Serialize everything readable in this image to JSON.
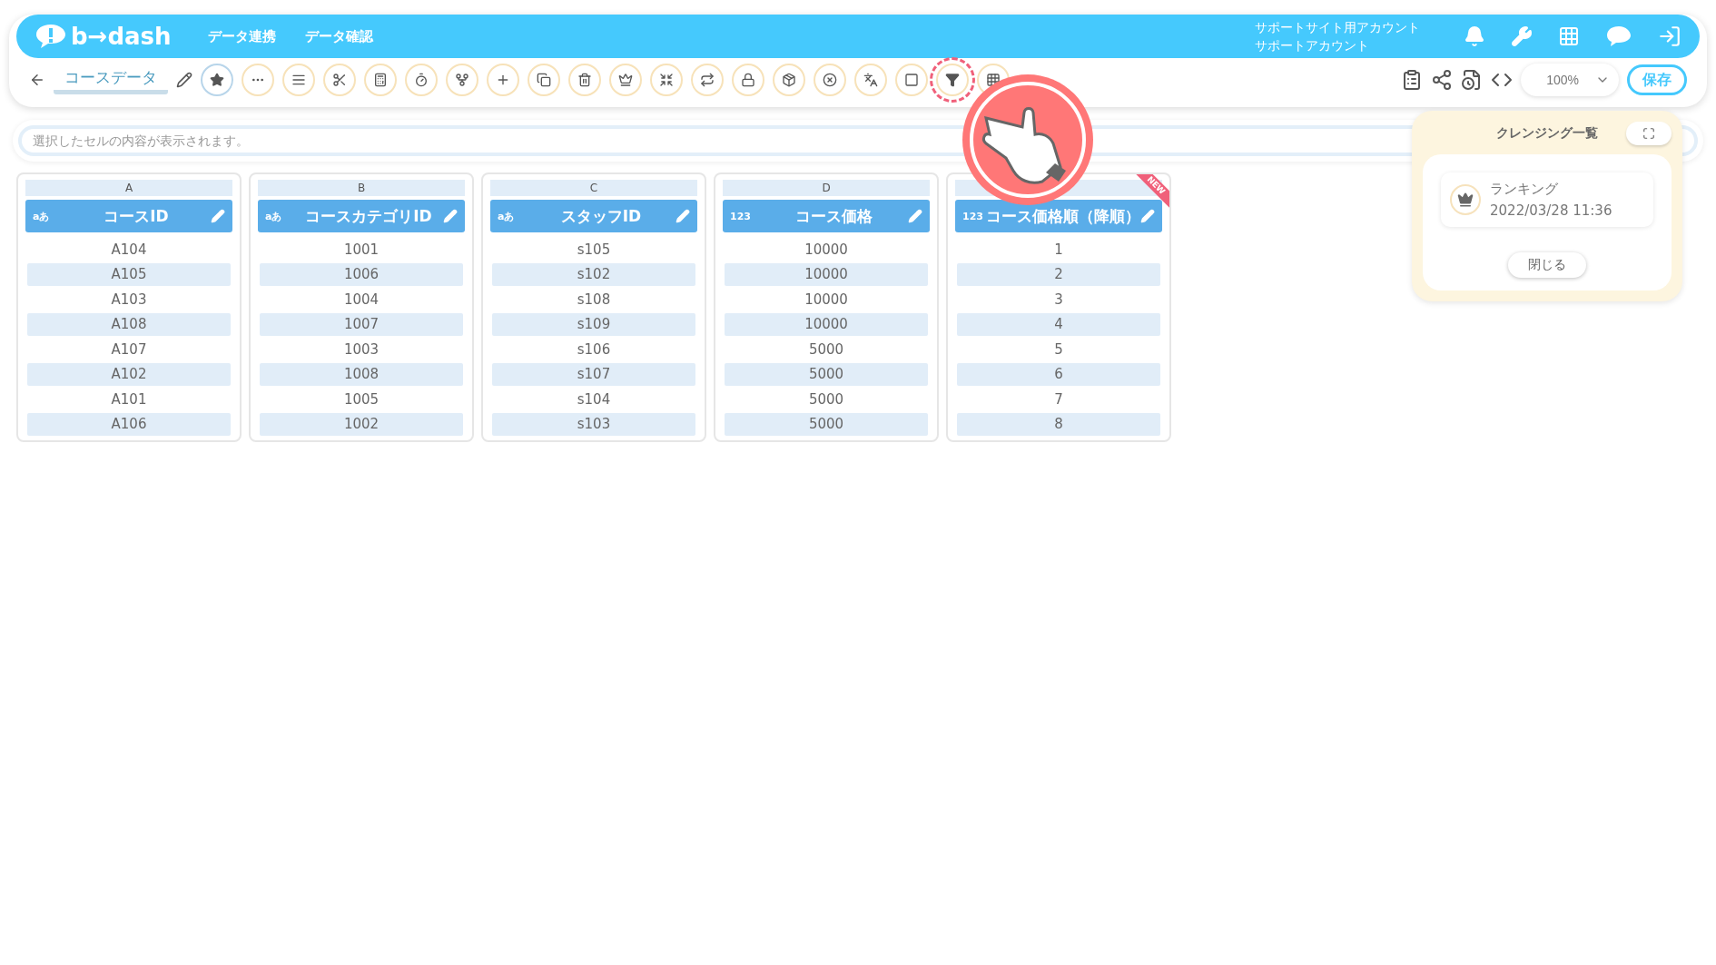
{
  "header": {
    "logo": "b→dash",
    "nav": [
      {
        "label": "データ連携"
      },
      {
        "label": "データ確認"
      }
    ],
    "account": [
      "サポートサイト用アカウント",
      "サポートアカウント"
    ]
  },
  "toolbar": {
    "title": "コースデータ",
    "tools": [
      {
        "selected": true,
        "highlighted": false
      },
      {
        "selected": false,
        "highlighted": false
      },
      {
        "selected": false,
        "highlighted": false
      },
      {
        "selected": false,
        "highlighted": false
      },
      {
        "selected": false,
        "highlighted": false
      },
      {
        "selected": false,
        "highlighted": false
      },
      {
        "selected": false,
        "highlighted": false
      },
      {
        "selected": false,
        "highlighted": false
      },
      {
        "selected": false,
        "highlighted": false
      },
      {
        "selected": false,
        "highlighted": false
      },
      {
        "selected": false,
        "highlighted": false
      },
      {
        "selected": false,
        "highlighted": false
      },
      {
        "selected": false,
        "highlighted": false
      },
      {
        "selected": false,
        "highlighted": false
      },
      {
        "selected": false,
        "highlighted": false
      },
      {
        "selected": false,
        "highlighted": false
      },
      {
        "selected": false,
        "highlighted": false
      },
      {
        "selected": false,
        "highlighted": false
      },
      {
        "selected": false,
        "highlighted": true
      },
      {
        "selected": false,
        "highlighted": false
      }
    ],
    "zoom": "100%",
    "save": "保存"
  },
  "cell_bar": {
    "placeholder": "選択したセルの内容が表示されます。"
  },
  "columns": [
    {
      "letter": "A",
      "type": "aあ",
      "title": "コースID",
      "cells": [
        "A104",
        "A105",
        "A103",
        "A108",
        "A107",
        "A102",
        "A101",
        "A106"
      ]
    },
    {
      "letter": "B",
      "type": "aあ",
      "title": "コースカテゴリID",
      "cells": [
        "1001",
        "1006",
        "1004",
        "1007",
        "1003",
        "1008",
        "1005",
        "1002"
      ]
    },
    {
      "letter": "C",
      "type": "aあ",
      "title": "スタッフID",
      "cells": [
        "s105",
        "s102",
        "s108",
        "s109",
        "s106",
        "s107",
        "s104",
        "s103"
      ]
    },
    {
      "letter": "D",
      "type": "123",
      "title": "コース価格",
      "cells": [
        "10000",
        "10000",
        "10000",
        "10000",
        "5000",
        "5000",
        "5000",
        "5000"
      ]
    },
    {
      "type": "123",
      "title": "コース価格順（降順）",
      "badge": "NEW",
      "cells": [
        "1",
        "2",
        "3",
        "4",
        "5",
        "6",
        "7",
        "8"
      ]
    }
  ],
  "cleansing_panel": {
    "title": "クレンジング一覧",
    "items": [
      {
        "name": "ランキング",
        "date": "2022/03/28 11:36"
      }
    ],
    "close": "閉じる"
  }
}
